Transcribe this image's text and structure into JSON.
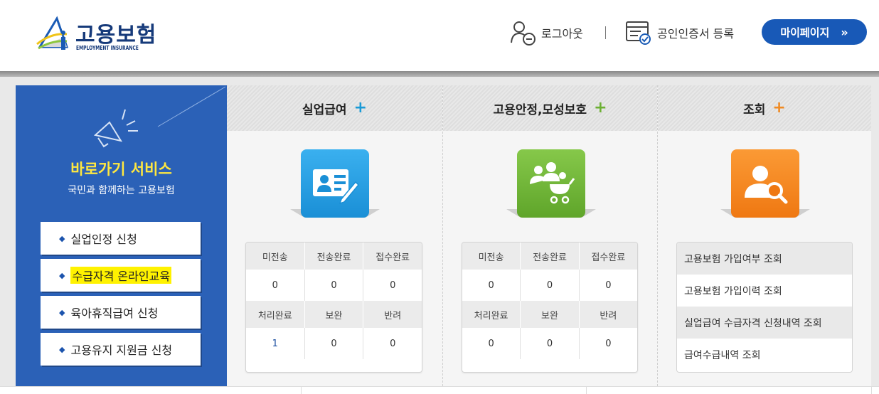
{
  "header": {
    "logo_title": "고용보험",
    "logo_sub": "EMPLOYMENT INSURANCE",
    "logout_label": "로그아웃",
    "cert_label": "공인인증서 등록",
    "mypage_label": "마이페이지",
    "mypage_arrow": "»"
  },
  "quick": {
    "title": "바로가기 서비스",
    "subtitle": "국민과 함께하는 고용보험",
    "bullet": "◆",
    "items": [
      {
        "label": "실업인정 신청"
      },
      {
        "label": "수급자격 온라인교육"
      },
      {
        "label": "육아휴직급여 신청"
      },
      {
        "label": "고용유지 지원금 신청"
      }
    ]
  },
  "columns": [
    {
      "title": "실업급여",
      "plus": "+",
      "plus_color": "#1a9ad6",
      "tile_color": "#27a3e3",
      "row1_headers": [
        "미전송",
        "전송완료",
        "접수완료"
      ],
      "row1_values": [
        "0",
        "0",
        "0"
      ],
      "row2_headers": [
        "처리완료",
        "보완",
        "반려"
      ],
      "row2_values": [
        "1",
        "0",
        "0"
      ]
    },
    {
      "title": "고용안정,모성보호",
      "plus": "+",
      "plus_color": "#6cb033",
      "tile_color": "#74b838",
      "row1_headers": [
        "미전송",
        "전송완료",
        "접수완료"
      ],
      "row1_values": [
        "0",
        "0",
        "0"
      ],
      "row2_headers": [
        "처리완료",
        "보완",
        "반려"
      ],
      "row2_values": [
        "0",
        "0",
        "0"
      ]
    },
    {
      "title": "조회",
      "plus": "+",
      "plus_color": "#f08a22",
      "tile_color": "#f7891f",
      "links": [
        {
          "label": "고용보험 가입여부 조회"
        },
        {
          "label": "고용보험 가입이력 조회"
        },
        {
          "label": "실업급여 수급자격 신청내역 조회"
        },
        {
          "label": "급여수급내역 조회"
        }
      ]
    }
  ]
}
